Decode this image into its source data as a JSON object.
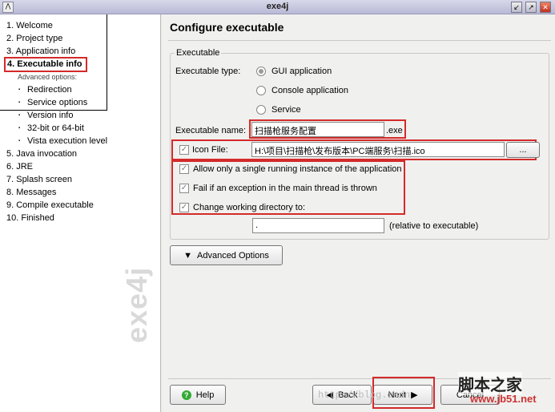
{
  "window": {
    "title": "exe4j",
    "min": "↙",
    "max": "↗",
    "close": "✕"
  },
  "sidebar": {
    "steps": [
      "1. Welcome",
      "2. Project type",
      "3. Application info",
      "4. Executable info"
    ],
    "advanced_label": "Advanced options:",
    "advanced": [
      "Redirection",
      "Service options",
      "Version info",
      "32-bit or 64-bit",
      "Vista execution level"
    ],
    "more_steps": [
      "5. Java invocation",
      "6. JRE",
      "7. Splash screen",
      "8. Messages",
      "9. Compile executable",
      "10. Finished"
    ],
    "logo": "exe4j",
    "active": "4. Executable info"
  },
  "main": {
    "heading": "Configure executable",
    "group_title": "Executable",
    "type_label": "Executable type:",
    "types": [
      {
        "label": "GUI application",
        "selected": true
      },
      {
        "label": "Console application",
        "selected": false
      },
      {
        "label": "Service",
        "selected": false
      }
    ],
    "name_label": "Executable name:",
    "name_value": "扫描枪服务配置",
    "name_suffix": ".exe",
    "icon_label": "Icon File:",
    "icon_checked": true,
    "icon_value": "H:\\项目\\扫描枪\\发布版本\\PC端服务\\扫描.ico",
    "browse": "...",
    "options": [
      {
        "label": "Allow only a single running instance of the application",
        "checked": true
      },
      {
        "label": "Fail if an exception in the main thread is thrown",
        "checked": true
      },
      {
        "label": "Change working directory to:",
        "checked": true
      }
    ],
    "workdir_value": ".",
    "workdir_hint": "(relative to executable)",
    "advanced_button": "Advanced Options"
  },
  "footer": {
    "help": "Help",
    "back": "Back",
    "next": "Next",
    "cancel": "Cancel"
  },
  "watermark": {
    "site_cn": "脚本之家",
    "site_url": "www.jb51.net",
    "blog": "http://blog.csdn"
  },
  "colors": {
    "highlight": "#d42a2a"
  }
}
